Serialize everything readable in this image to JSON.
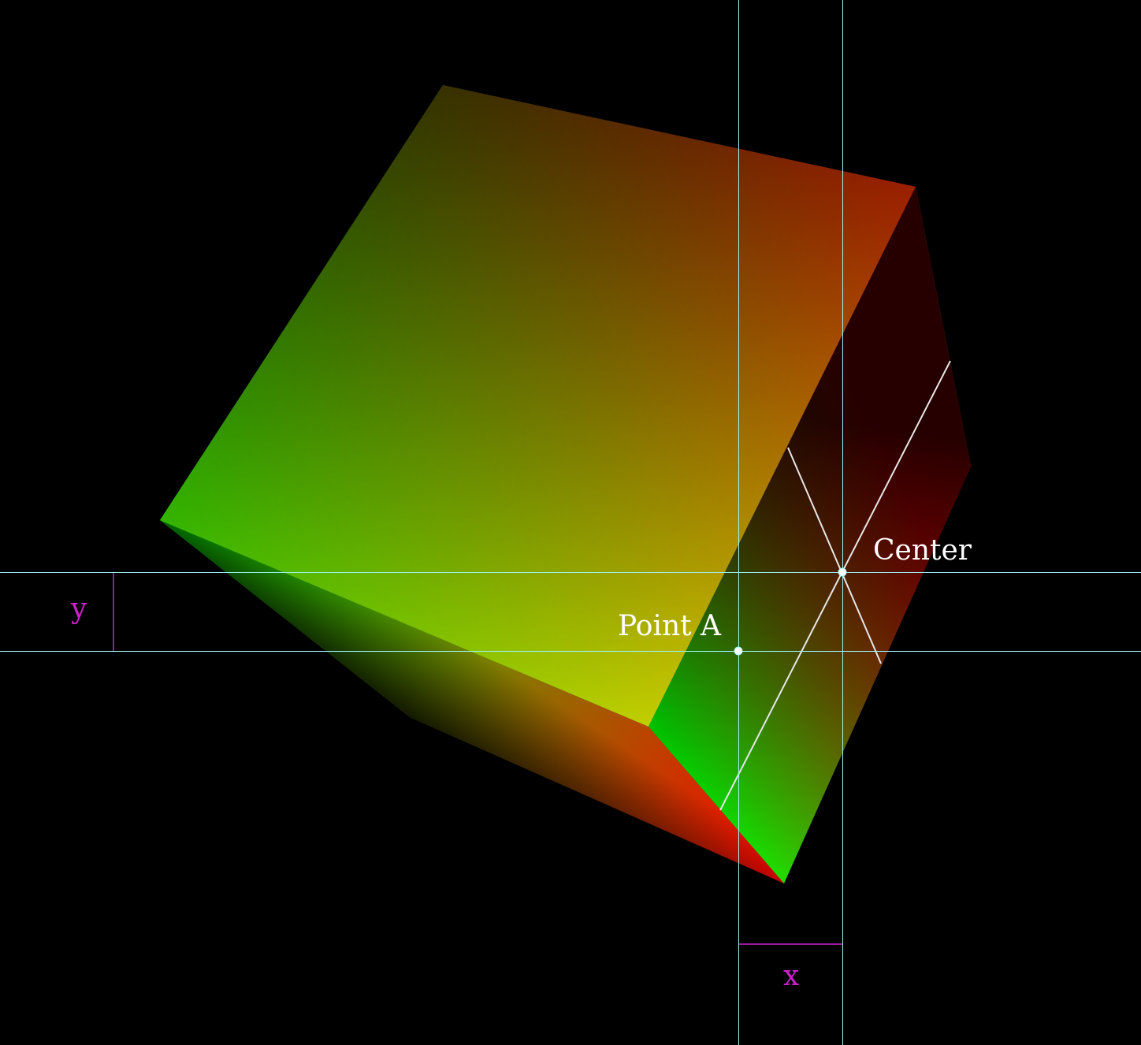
{
  "background": "#000000",
  "colors": {
    "guide": "#9ff3f3",
    "dimension": "#cc22cc",
    "label": "#ffffff",
    "red": "#ff0000",
    "green": "#00ff00",
    "yellow": "#ffff00",
    "black": "#000000"
  },
  "labels": {
    "center": "Center",
    "point_a": "Point A",
    "x": "x",
    "y": "y"
  }
}
